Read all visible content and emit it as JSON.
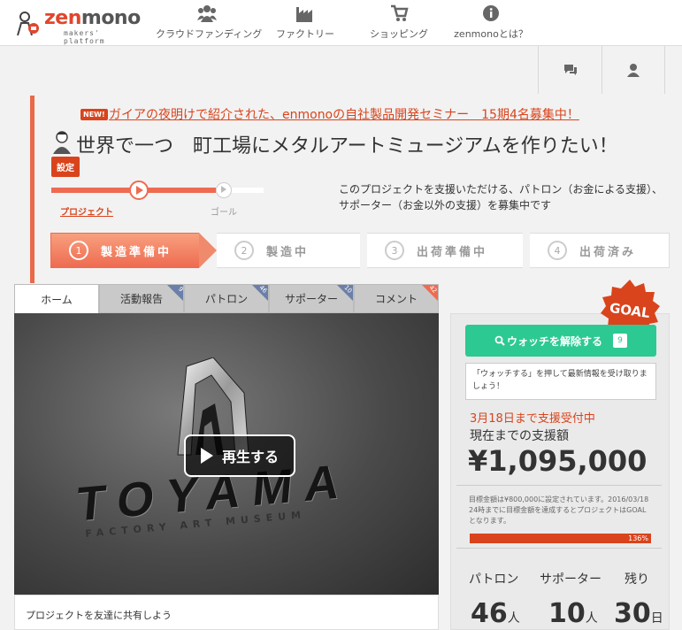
{
  "brand": {
    "name_part1": "zen",
    "name_part2": "mono",
    "tagline": "makers' platform"
  },
  "nav": [
    {
      "label": "クラウドファンディング",
      "icon": "people-icon"
    },
    {
      "label": "ファクトリー",
      "icon": "factory-icon"
    },
    {
      "label": "ショッピング",
      "icon": "cart-icon"
    },
    {
      "label": "zenmonoとは？",
      "icon": "info-icon"
    }
  ],
  "header_icons": {
    "messages": "chat-icon",
    "user": "user-icon"
  },
  "announcement": {
    "badge": "NEW!",
    "text": "ガイアの夜明けで紹介された、enmonoの自社製品開発セミナー　15期4名募集中！"
  },
  "project": {
    "title": "世界で一つ　町工場にメタルアートミュージアムを作りたい！",
    "settings_label": "設定",
    "progress_label_project": "プロジェクト",
    "progress_label_goal": "ゴール",
    "support_text": "このプロジェクトを支援いただける、パトロン（お金による支援）、サポーター（お金以外の支援）を募集中です"
  },
  "steps": [
    {
      "num": "1",
      "label": "製造準備中",
      "active": true
    },
    {
      "num": "2",
      "label": "製造中",
      "active": false
    },
    {
      "num": "3",
      "label": "出荷準備中",
      "active": false
    },
    {
      "num": "4",
      "label": "出荷済み",
      "active": false
    }
  ],
  "tabs": [
    {
      "label": "ホーム",
      "count": ""
    },
    {
      "label": "活動報告",
      "count": "9"
    },
    {
      "label": "パトロン",
      "count": "46"
    },
    {
      "label": "サポーター",
      "count": "10"
    },
    {
      "label": "コメント",
      "count": "42"
    }
  ],
  "video": {
    "logo_text": "TOYAMA",
    "logo_subtext": "FACTORY ART MUSEUM",
    "play_label": "再生する"
  },
  "share_text": "プロジェクトを友達に共有しよう",
  "sidebar": {
    "goal_badge": "GOAL",
    "watch_label": "ウォッチを解除する",
    "watch_count": "9",
    "watch_tip": "「ウォッチする」を押して最新情報を受け取りましょう！",
    "deadline": "3月18日まで支援受付中",
    "raised_label": "現在までの支援額",
    "raised_amount": "¥1,095,000",
    "goal_text": "目標金額は¥800,000に設定されています。2016/03/18 24時までに目標金額を達成するとプロジェクトはGOALとなります。",
    "goal_percent": "136%",
    "stats": [
      {
        "label": "パトロン",
        "value": "46",
        "unit": "人"
      },
      {
        "label": "サポーター",
        "value": "10",
        "unit": "人"
      },
      {
        "label": "残り",
        "value": "30",
        "unit": "日"
      }
    ]
  },
  "colors": {
    "accent": "#ee6b51",
    "brand_red": "#d9441c",
    "watch_green": "#2dc993",
    "tab_corner": "#6b7fa8"
  }
}
